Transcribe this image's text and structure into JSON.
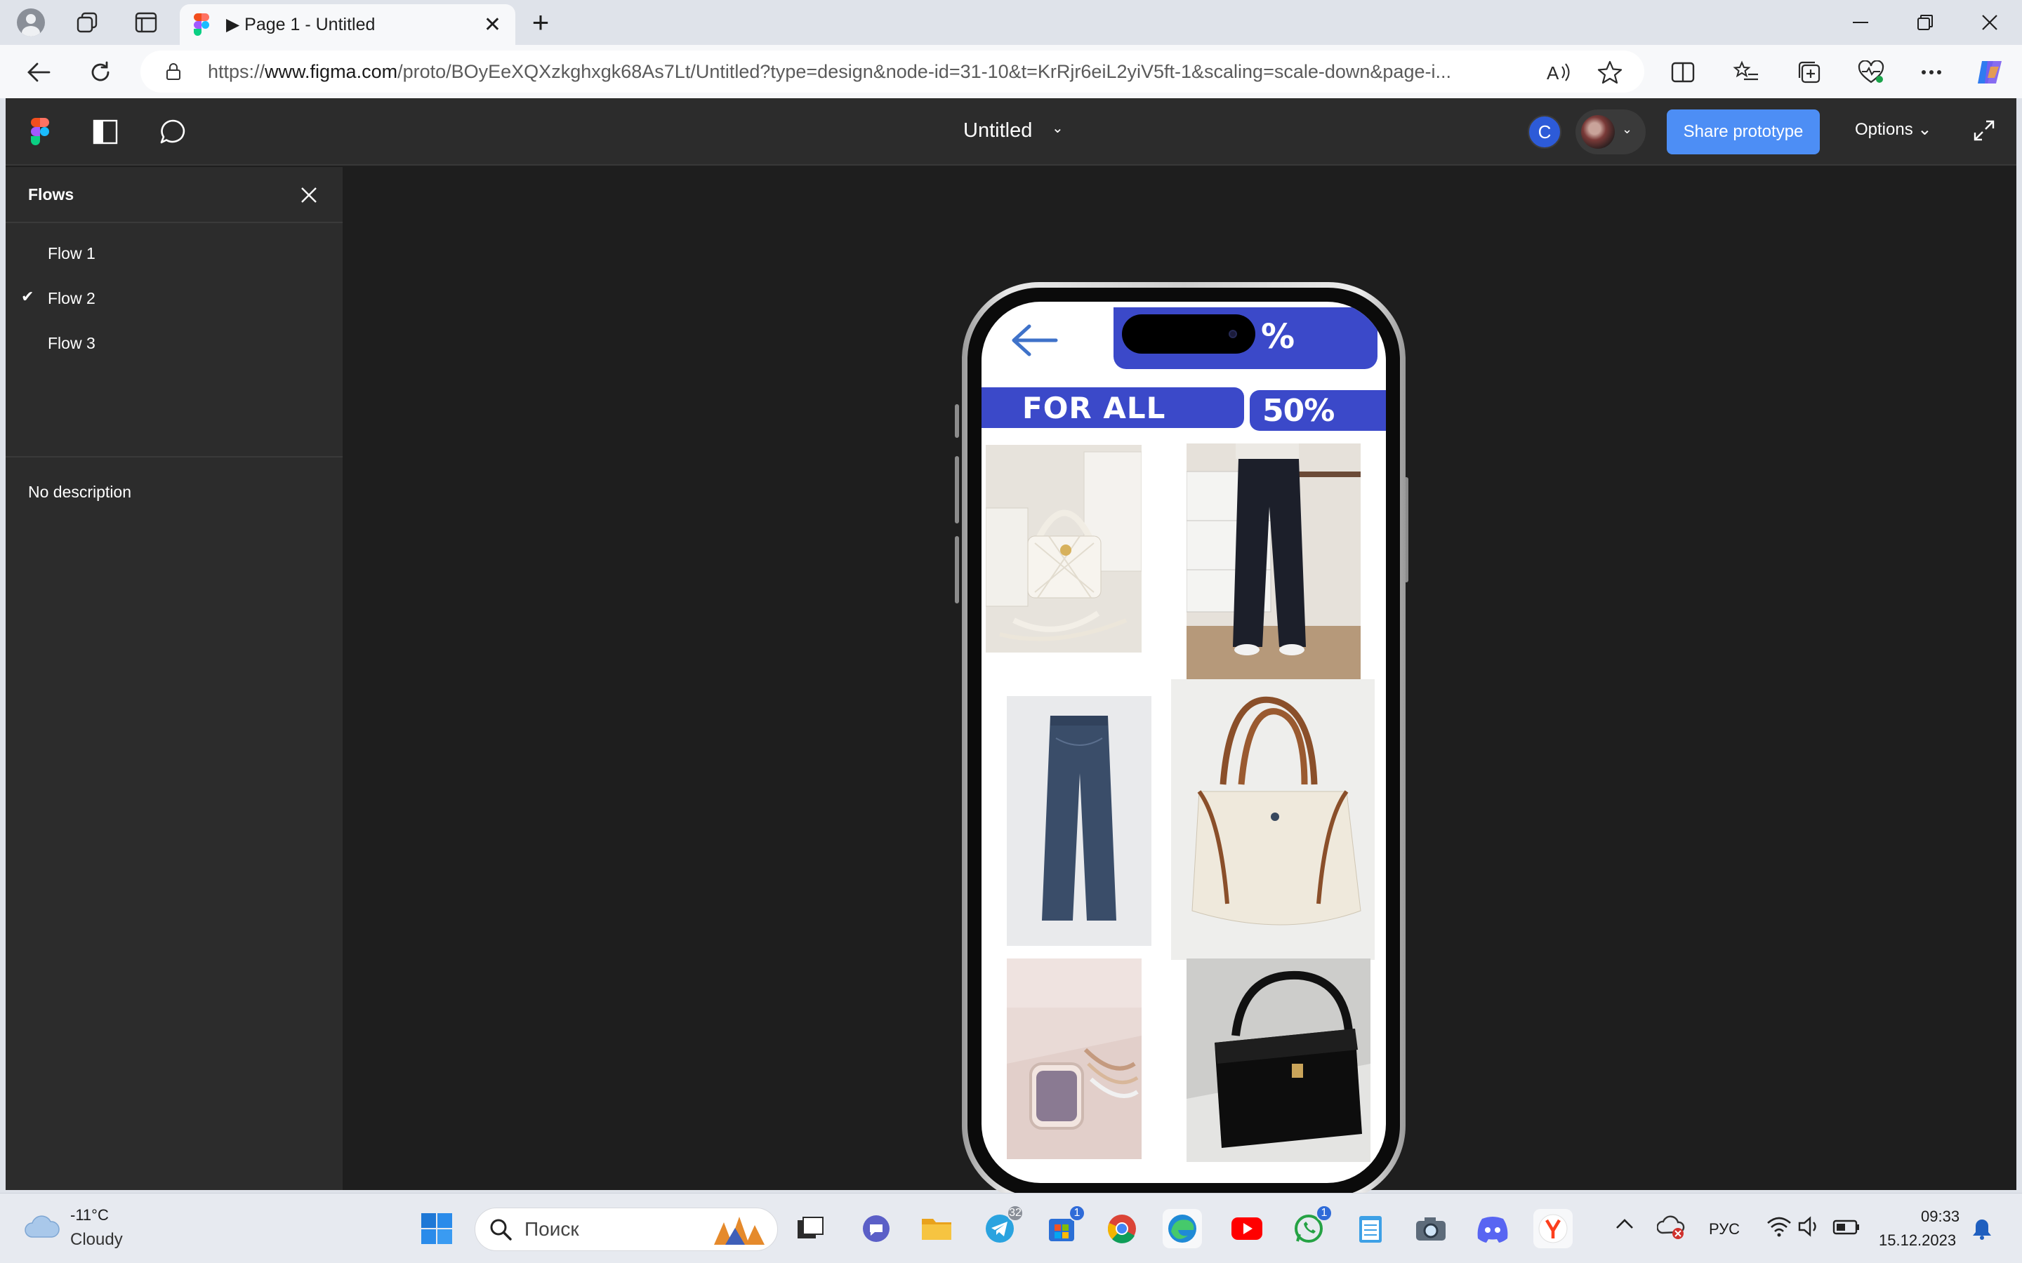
{
  "browser": {
    "tab_title": "▶ Page 1 - Untitled",
    "tab_close": "✕",
    "new_tab": "+",
    "url_prefix": "https://",
    "url_domain": "www.figma.com",
    "url_path": "/proto/BOyEeXQXzkghxgk68As7Lt/Untitled?type=design&node-id=31-10&t=KrRjr6eiL2yiV5ft-1&scaling=scale-down&page-i..."
  },
  "figma": {
    "document_title": "Untitled",
    "title_caret": "⌄",
    "user_initial": "C",
    "share_button": "Share prototype",
    "options_label": "Options ⌄",
    "accent": "#4d8ef5",
    "sidebar": {
      "title": "Flows",
      "flows": [
        {
          "label": "Flow 1",
          "checked": false
        },
        {
          "label": "Flow 2",
          "checked": true
        },
        {
          "label": "Flow 3",
          "checked": false
        }
      ],
      "check_mark": "✔",
      "description": "No description"
    }
  },
  "prototype": {
    "promo_top": "%",
    "banner_left": "FOR ALL",
    "banner_right": "50%",
    "brand_color": "#3b49c9",
    "products": [
      {
        "name": "white quilted handbag"
      },
      {
        "name": "black wide-leg trousers"
      },
      {
        "name": "blue straight jeans"
      },
      {
        "name": "cream tote bag with brown handles"
      },
      {
        "name": "smartwatch with bracelets"
      },
      {
        "name": "black leather shoulder bag"
      }
    ]
  },
  "taskbar": {
    "temperature": "-11°C",
    "weather": "Cloudy",
    "search_placeholder": "Поиск",
    "telegram_badge": "32",
    "store_badge": "1",
    "whatsapp_badge": "1",
    "language": "РУС",
    "time": "09:33",
    "date": "15.12.2023"
  }
}
